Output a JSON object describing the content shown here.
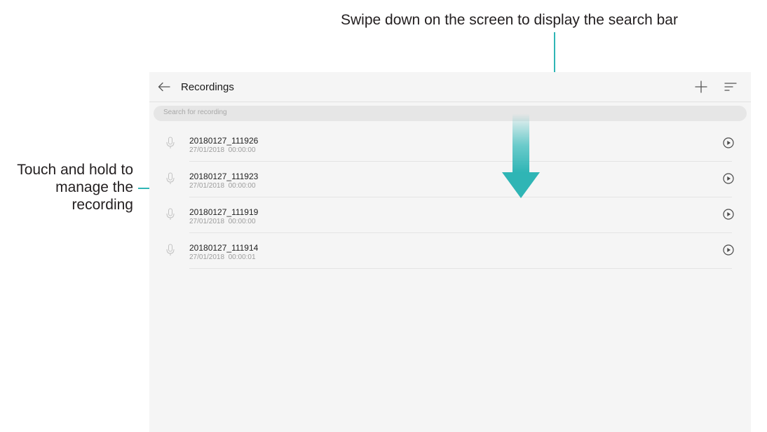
{
  "callouts": {
    "search_hint": "Swipe down on the screen to display the search bar",
    "manage_hint": "Touch and hold to manage the recording"
  },
  "app_bar": {
    "title": "Recordings",
    "back_icon": "arrow-left-icon",
    "add_icon": "plus-icon",
    "sort_icon": "sort-icon"
  },
  "search": {
    "placeholder": "Search for recording"
  },
  "recordings": [
    {
      "name": "20180127_111926",
      "date": "27/01/2018",
      "duration": "00:00:00"
    },
    {
      "name": "20180127_111923",
      "date": "27/01/2018",
      "duration": "00:00:00"
    },
    {
      "name": "20180127_111919",
      "date": "27/01/2018",
      "duration": "00:00:00"
    },
    {
      "name": "20180127_111914",
      "date": "27/01/2018",
      "duration": "00:00:01"
    }
  ],
  "colors": {
    "accent": "#2fb5b5",
    "screen_background": "#f5f5f5",
    "search_bar": "#e6e6e6"
  }
}
